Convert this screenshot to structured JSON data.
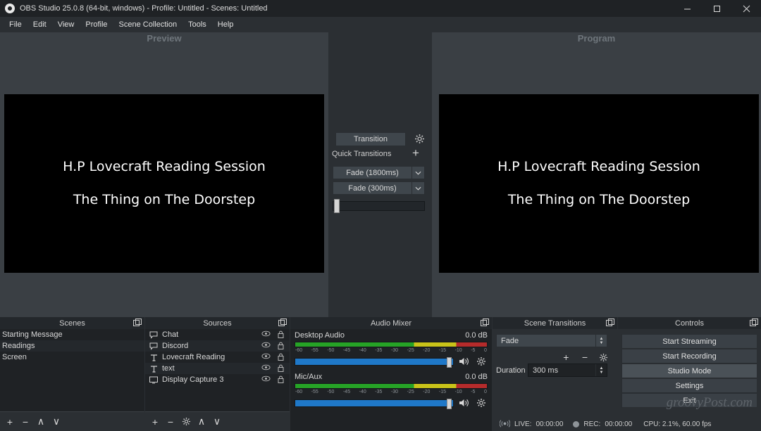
{
  "window": {
    "title": "OBS Studio 25.0.8 (64-bit, windows) - Profile: Untitled - Scenes: Untitled",
    "minimize": "─",
    "maximize": "□",
    "close": "✕"
  },
  "menu": {
    "items": [
      "File",
      "Edit",
      "View",
      "Profile",
      "Scene Collection",
      "Tools",
      "Help"
    ]
  },
  "preview": {
    "label": "Preview",
    "line1": "H.P Lovecraft Reading Session",
    "line2": "The Thing on The Doorstep"
  },
  "program": {
    "label": "Program",
    "line1": "H.P Lovecraft Reading Session",
    "line2": "The Thing on The Doorstep"
  },
  "transitions_mid": {
    "transition_button": "Transition",
    "quick_transitions_label": "Quick Transitions",
    "add_label": "+",
    "fade1": "Fade (1800ms)",
    "fade2": "Fade (300ms)"
  },
  "scenes": {
    "title": "Scenes",
    "items": [
      "Starting Message",
      "Readings",
      "Screen"
    ],
    "toolbar": {
      "add": "+",
      "remove": "−",
      "up": "∧",
      "down": "∨"
    }
  },
  "sources": {
    "title": "Sources",
    "items": [
      {
        "name": "Chat",
        "icon": "speech-bubble"
      },
      {
        "name": "Discord",
        "icon": "speech-bubble"
      },
      {
        "name": "Lovecraft Reading",
        "icon": "text"
      },
      {
        "name": "text",
        "icon": "text"
      },
      {
        "name": "Display Capture 3",
        "icon": "monitor"
      }
    ],
    "toolbar": {
      "add": "+",
      "remove": "−",
      "settings": "gear",
      "up": "∧",
      "down": "∨"
    }
  },
  "mixer": {
    "title": "Audio Mixer",
    "channels": [
      {
        "name": "Desktop Audio",
        "level": "0.0 dB"
      },
      {
        "name": "Mic/Aux",
        "level": "0.0 dB"
      }
    ],
    "scale": [
      "-60",
      "-55",
      "-50",
      "-45",
      "-40",
      "-35",
      "-30",
      "-25",
      "-20",
      "-15",
      "-10",
      "-5",
      "0"
    ]
  },
  "scene_transitions": {
    "title": "Scene Transitions",
    "selected": "Fade",
    "duration_label": "Duration",
    "duration_value": "300 ms",
    "add": "+",
    "remove": "−",
    "settings": "gear"
  },
  "controls": {
    "title": "Controls",
    "buttons": [
      {
        "label": "Start Streaming",
        "active": false
      },
      {
        "label": "Start Recording",
        "active": false
      },
      {
        "label": "Studio Mode",
        "active": true
      },
      {
        "label": "Settings",
        "active": false
      },
      {
        "label": "Exit",
        "active": false
      }
    ]
  },
  "status": {
    "live_label": "LIVE:",
    "live_time": "00:00:00",
    "rec_label": "REC:",
    "rec_time": "00:00:00",
    "cpu": "CPU: 2.1%, 60.00 fps"
  },
  "watermark": "groovyPost.com"
}
